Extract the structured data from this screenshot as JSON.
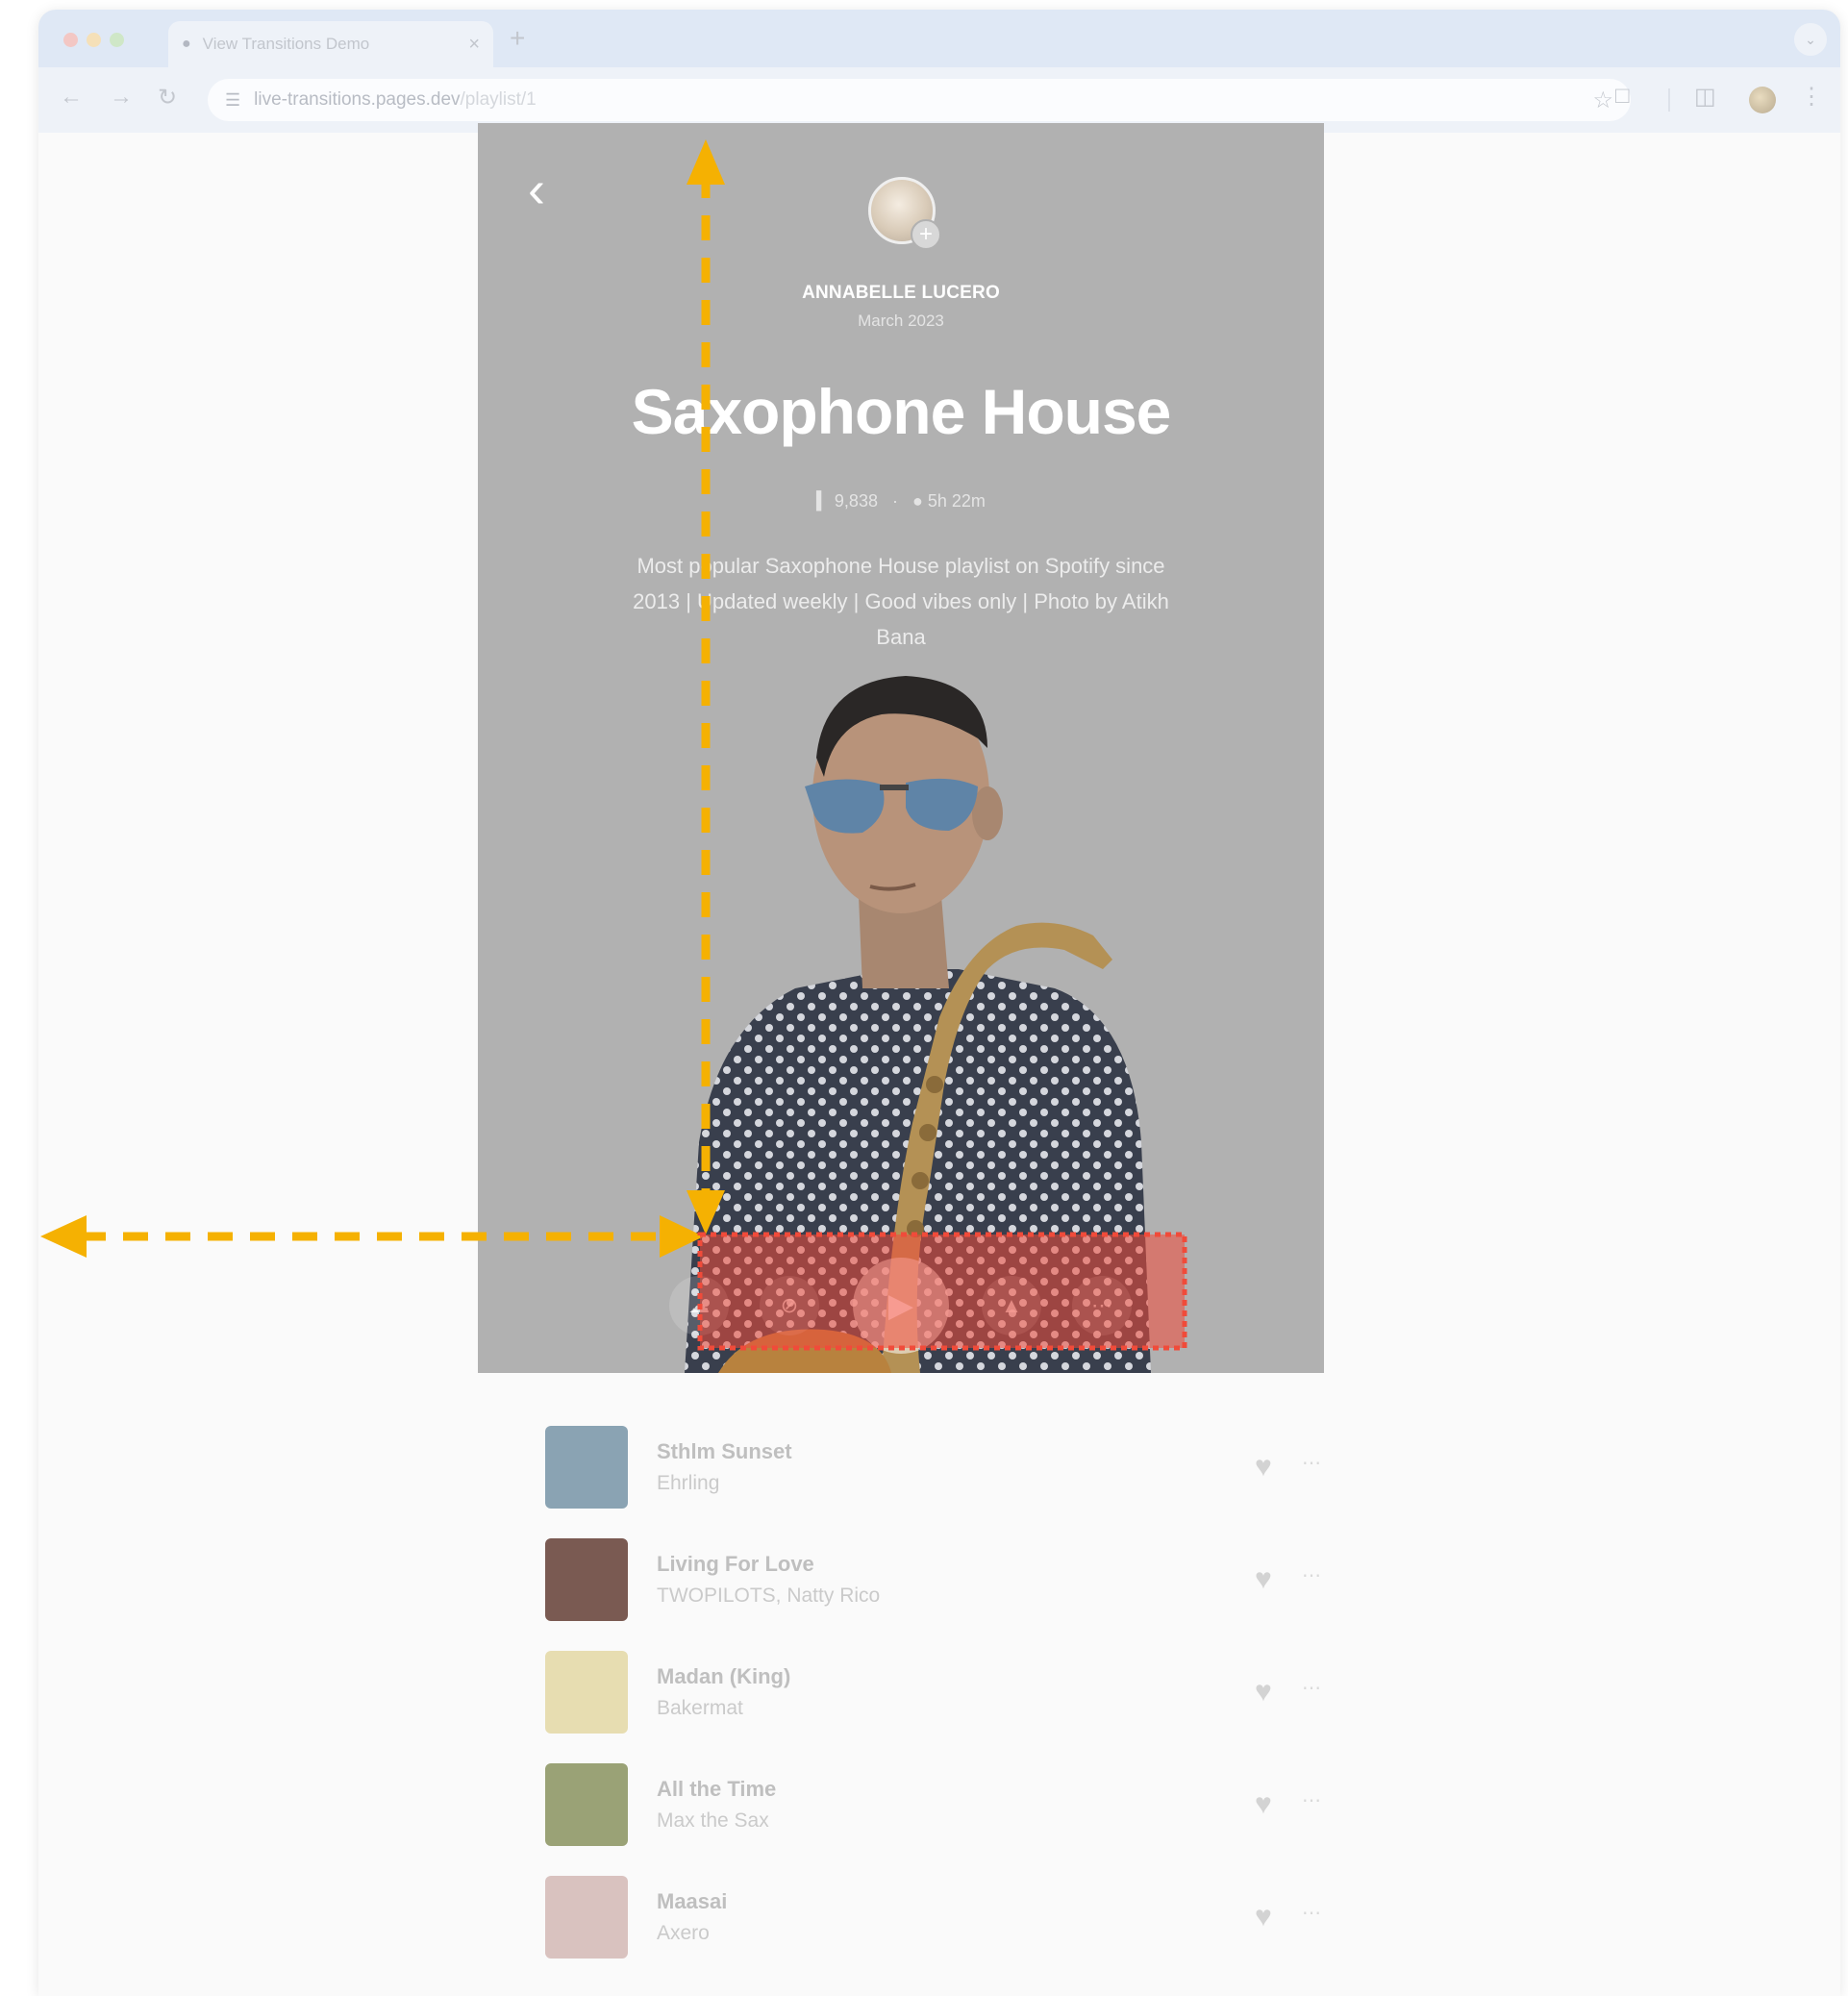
{
  "browser": {
    "tab_title": "View Transitions Demo",
    "new_tab": "+",
    "url_host": "live-transitions.pages.dev",
    "url_path": "/playlist/1"
  },
  "playlist": {
    "author": "ANNABELLE LUCERO",
    "date": "March 2023",
    "title": "Saxophone House",
    "plays": "9,838",
    "separator": "·",
    "duration": "5h 22m",
    "description": "Most popular Saxophone House playlist on Spotify since 2013 | Updated weekly | Good vibes only | Photo by Atikh Bana"
  },
  "tracks": [
    {
      "title": "Sthlm Sunset",
      "artist": "Ehrling",
      "cover_color": "#8aa3b3"
    },
    {
      "title": "Living For Love",
      "artist": "TWOPILOTS, Natty Rico",
      "cover_color": "#7a5a52"
    },
    {
      "title": "Madan (King)",
      "artist": "Bakermat",
      "cover_color": "#e7ddb1"
    },
    {
      "title": "All the Time",
      "artist": "Max the Sax",
      "cover_color": "#9aa276"
    },
    {
      "title": "Maasai",
      "artist": "Axero",
      "cover_color": "#d9c2bf"
    }
  ],
  "colors": {
    "annotation_arrow": "#f5b102",
    "highlight_box": "#f04b3a",
    "hero_bg": "#b1b1b1"
  }
}
